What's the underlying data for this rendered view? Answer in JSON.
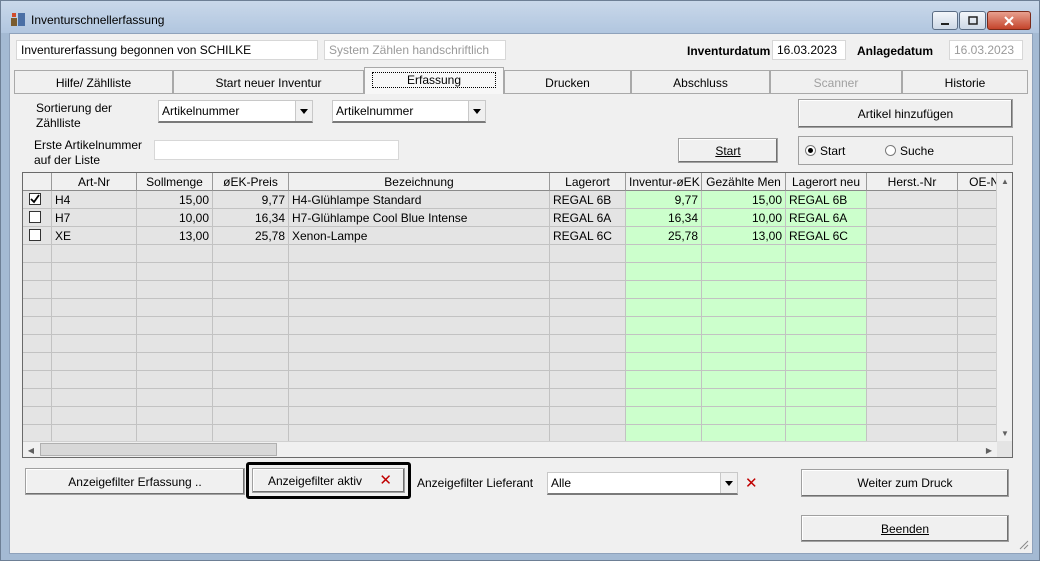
{
  "window": {
    "title": "Inventurschnellerfassung"
  },
  "header": {
    "started_by": "Inventurerfassung begonnen von SCHILKE",
    "system_mode": "System Zählen handschriftlich",
    "inventurdatum_label": "Inventurdatum",
    "inventurdatum_value": "16.03.2023",
    "anlagedatum_label": "Anlagedatum",
    "anlagedatum_value": "16.03.2023"
  },
  "tabs": [
    {
      "label": "Hilfe/ Zählliste"
    },
    {
      "label": "Start neuer Inventur"
    },
    {
      "label": "Erfassung"
    },
    {
      "label": "Drucken"
    },
    {
      "label": "Abschluss"
    },
    {
      "label": "Scanner"
    },
    {
      "label": "Historie"
    }
  ],
  "controls": {
    "sort_label_1": "Sortierung der",
    "sort_label_2": "Zählliste",
    "sort_combo_1": "Artikelnummer",
    "sort_combo_2": "Artikelnummer",
    "add_article_button": "Artikel hinzufügen",
    "first_art_label_1": "Erste Artikelnummer",
    "first_art_label_2": "auf der Liste",
    "first_art_value": "",
    "start_button": "Start",
    "radio_start": "Start",
    "radio_suche": "Suche"
  },
  "grid": {
    "columns": [
      "",
      "Art-Nr",
      "Sollmenge",
      "øEK-Preis",
      "Bezeichnung",
      "Lagerort",
      "Inventur-øEK",
      "Gezählte Men",
      "Lagerort neu",
      "Herst.-Nr",
      "OE-Nu"
    ],
    "rows": [
      {
        "checked": true,
        "artnr": "H4",
        "soll": "15,00",
        "ek": "9,77",
        "bez": "H4-Glühlampe Standard",
        "lager": "REGAL 6B",
        "inv_ek": "9,77",
        "gez": "15,00",
        "lager_neu": "REGAL 6B",
        "herst": "",
        "oe": ""
      },
      {
        "checked": false,
        "artnr": "H7",
        "soll": "10,00",
        "ek": "16,34",
        "bez": "H7-Glühlampe Cool Blue Intense",
        "lager": "REGAL 6A",
        "inv_ek": "16,34",
        "gez": "10,00",
        "lager_neu": "REGAL 6A",
        "herst": "",
        "oe": ""
      },
      {
        "checked": false,
        "artnr": "XE",
        "soll": "13,00",
        "ek": "25,78",
        "bez": "Xenon-Lampe",
        "lager": "REGAL 6C",
        "inv_ek": "25,78",
        "gez": "13,00",
        "lager_neu": "REGAL 6C",
        "herst": "",
        "oe": ""
      }
    ],
    "empty_rows": 11
  },
  "footer": {
    "filter_erfassung_button": "Anzeigefilter Erfassung ..",
    "filter_aktiv_button": "Anzeigefilter aktiv",
    "filter_lieferant_label": "Anzeigefilter Lieferant",
    "filter_lieferant_value": "Alle",
    "weiter_button": "Weiter zum Druck",
    "beenden_button": "Beenden"
  },
  "colors": {
    "highlight_green": "#ccffcc",
    "clear_red": "#c00000"
  }
}
